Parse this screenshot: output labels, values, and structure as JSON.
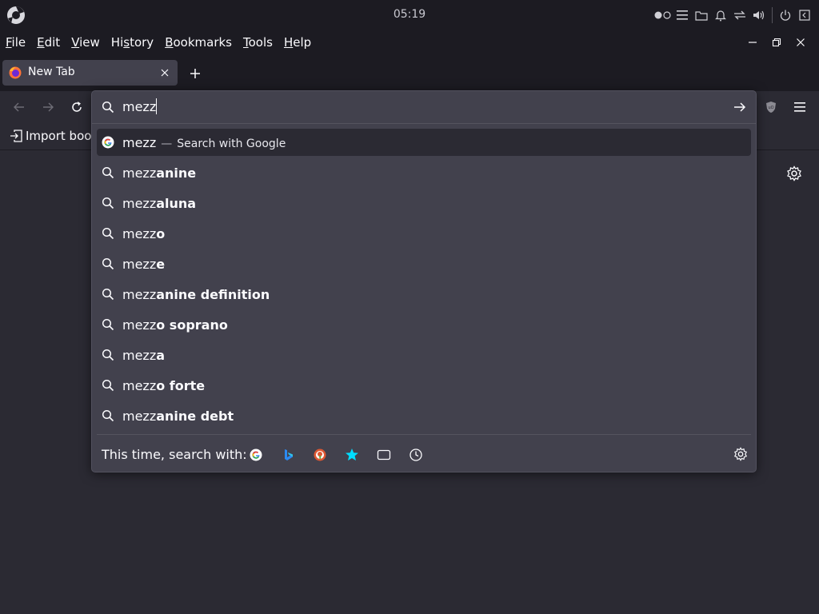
{
  "panel": {
    "clock": "05:19"
  },
  "menubar": {
    "items": [
      {
        "mnemonic": "F",
        "rest": "ile"
      },
      {
        "mnemonic": "E",
        "rest": "dit"
      },
      {
        "mnemonic": "V",
        "rest": "iew"
      },
      {
        "mnemonic": "",
        "pre": "Hi",
        "mn2": "s",
        "rest": "tory"
      },
      {
        "mnemonic": "B",
        "rest": "ookmarks"
      },
      {
        "mnemonic": "T",
        "rest": "ools"
      },
      {
        "mnemonic": "H",
        "rest": "elp"
      }
    ]
  },
  "tabs": [
    {
      "title": "New Tab"
    }
  ],
  "bookmarks": {
    "import_label": "Import book"
  },
  "urlbar": {
    "typed": "mezz",
    "heuristic": {
      "query": "mezz",
      "separator": "—",
      "action": "Search with Google"
    },
    "suggestions": [
      {
        "typed": "mezz",
        "completion": "anine"
      },
      {
        "typed": "mezz",
        "completion": "aluna"
      },
      {
        "typed": "mezz",
        "completion": "o"
      },
      {
        "typed": "mezz",
        "completion": "e"
      },
      {
        "typed": "mezz",
        "completion": "anine definition"
      },
      {
        "typed": "mezz",
        "completion": "o soprano"
      },
      {
        "typed": "mezz",
        "completion": "a"
      },
      {
        "typed": "mezz",
        "completion": "o forte"
      },
      {
        "typed": "mezz",
        "completion": "anine debt"
      }
    ],
    "oneoff_label": "This time, search with:",
    "engines": [
      "google-icon",
      "bing-icon",
      "duckduckgo-icon",
      "bookmarks-star-icon",
      "tabs-icon",
      "history-icon"
    ]
  },
  "colors": {
    "panel_bg": "#1c1b22",
    "page_bg": "#2b2a33",
    "popup_bg": "#42414d",
    "accent": "#00ddff"
  }
}
